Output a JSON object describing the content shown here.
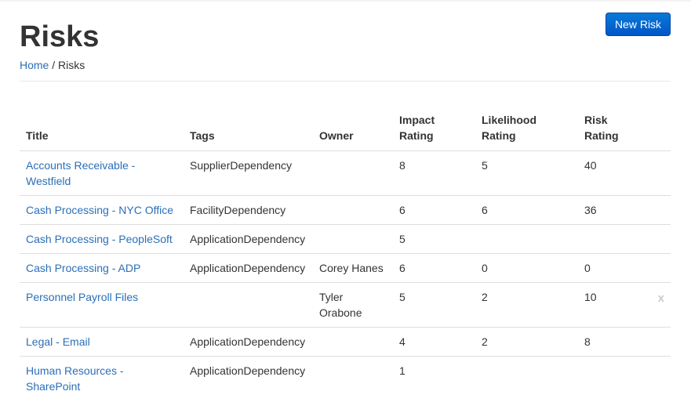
{
  "header": {
    "title": "Risks",
    "new_button_label": "New Risk"
  },
  "breadcrumb": {
    "home": "Home",
    "separator": "/",
    "current": "Risks"
  },
  "table": {
    "columns": {
      "title": "Title",
      "tags": "Tags",
      "owner": "Owner",
      "impact": "Impact Rating",
      "likelihood": "Likelihood Rating",
      "risk": "Risk Rating"
    },
    "rows": [
      {
        "title": "Accounts Receivable - Westfield",
        "tags": "SupplierDependency",
        "owner": "",
        "impact": "8",
        "likelihood": "5",
        "risk": "40",
        "delete": ""
      },
      {
        "title": "Cash Processing - NYC Office",
        "tags": "FacilityDependency",
        "owner": "",
        "impact": "6",
        "likelihood": "6",
        "risk": "36",
        "delete": ""
      },
      {
        "title": "Cash Processing - PeopleSoft",
        "tags": "ApplicationDependency",
        "owner": "",
        "impact": "5",
        "likelihood": "",
        "risk": "",
        "delete": ""
      },
      {
        "title": "Cash Processing - ADP",
        "tags": "ApplicationDependency",
        "owner": "Corey Hanes",
        "impact": "6",
        "likelihood": "0",
        "risk": "0",
        "delete": ""
      },
      {
        "title": "Personnel Payroll Files",
        "tags": "",
        "owner": "Tyler Orabone",
        "impact": "5",
        "likelihood": "2",
        "risk": "10",
        "delete": "x"
      },
      {
        "title": "Legal - Email",
        "tags": "ApplicationDependency",
        "owner": "",
        "impact": "4",
        "likelihood": "2",
        "risk": "8",
        "delete": ""
      },
      {
        "title": "Human Resources - SharePoint",
        "tags": "ApplicationDependency",
        "owner": "",
        "impact": "1",
        "likelihood": "",
        "risk": "",
        "delete": ""
      }
    ]
  },
  "colors": {
    "link": "#2a6fb8",
    "button": "#0066cc",
    "border": "#dddddd"
  }
}
